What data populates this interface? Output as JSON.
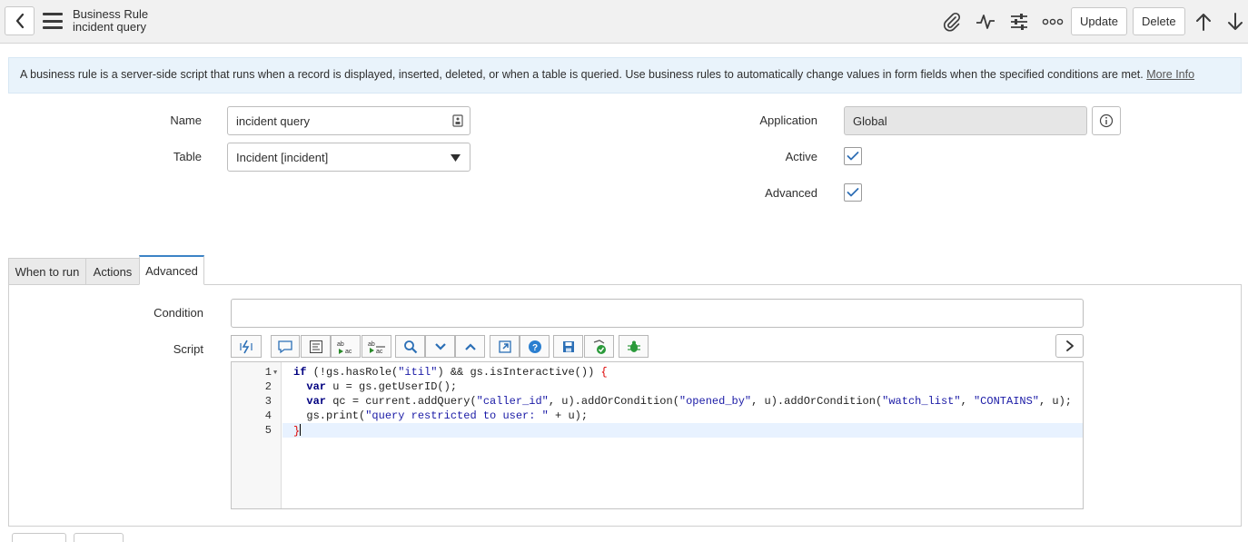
{
  "header": {
    "record_type": "Business Rule",
    "record_name": "incident query",
    "buttons": {
      "update": "Update",
      "delete": "Delete"
    }
  },
  "banner": {
    "text": "A business rule is a server-side script that runs when a record is displayed, inserted, deleted, or when a table is queried. Use business rules to automatically change values in form fields when the specified conditions are met.",
    "link": "More Info"
  },
  "form": {
    "name_label": "Name",
    "name_value": "incident query",
    "table_label": "Table",
    "table_value": "Incident [incident]",
    "application_label": "Application",
    "application_value": "Global",
    "active_label": "Active",
    "active_checked": true,
    "advanced_label": "Advanced",
    "advanced_checked": true
  },
  "tabs": [
    {
      "label": "When to run",
      "active": false
    },
    {
      "label": "Actions",
      "active": false
    },
    {
      "label": "Advanced",
      "active": true
    }
  ],
  "advanced": {
    "condition_label": "Condition",
    "condition_value": "",
    "script_label": "Script"
  },
  "editor": {
    "line_numbers": [
      "1",
      "2",
      "3",
      "4",
      "5"
    ],
    "toolbar_icons": [
      "format-code-icon",
      "comment-icon",
      "format-icon",
      "replace-icon",
      "replace-all-icon",
      "search-icon",
      "find-next-icon",
      "find-prev-icon",
      "fullscreen-icon",
      "help-icon",
      "save-icon",
      "check-syntax-icon",
      "debug-icon",
      "expand-icon"
    ],
    "lines": [
      "if (!gs.hasRole(\"itil\") && gs.isInteractive()) {",
      "  var u = gs.getUserID();",
      "  var qc = current.addQuery(\"caller_id\", u).addOrCondition(\"opened_by\", u).addOrCondition(\"watch_list\", \"CONTAINS\", u);",
      "  gs.print(\"query restricted to user: \" + u);",
      "}"
    ]
  },
  "colors": {
    "accent": "#3c84c6",
    "banner_bg": "#e9f3fb",
    "header_bg": "#f1f1f1",
    "keyword": "#000080",
    "string": "#1a1aa6"
  }
}
